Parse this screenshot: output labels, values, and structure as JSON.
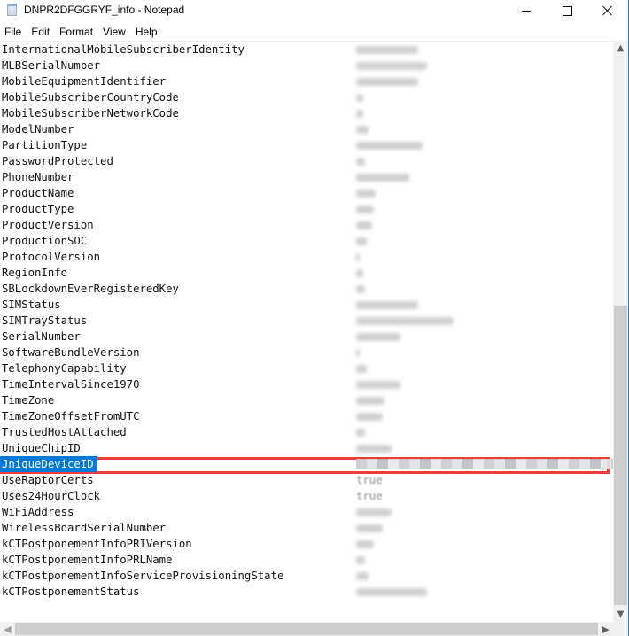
{
  "window": {
    "title": "DNPR2DFGGRYF_info - Notepad",
    "controls": {
      "minimize": "minimize",
      "maximize": "maximize",
      "close": "close"
    }
  },
  "menu": {
    "items": [
      "File",
      "Edit",
      "Format",
      "View",
      "Help"
    ]
  },
  "editor": {
    "selected_key": "UniqueDeviceID",
    "selected_text_visible": "JniqueDeviceID",
    "rows": [
      {
        "key": "InternationalMobileSubscriberIdentity",
        "value": "[redacted]"
      },
      {
        "key": "MLBSerialNumber",
        "value": "[redacted]"
      },
      {
        "key": "MobileEquipmentIdentifier",
        "value": "[redacted]"
      },
      {
        "key": "MobileSubscriberCountryCode",
        "value": "[redacted]"
      },
      {
        "key": "MobileSubscriberNetworkCode",
        "value": "[redacted]"
      },
      {
        "key": "ModelNumber",
        "value": "[redacted]"
      },
      {
        "key": "PartitionType",
        "value": "[redacted]"
      },
      {
        "key": "PasswordProtected",
        "value": "[redacted]"
      },
      {
        "key": "PhoneNumber",
        "value": "[redacted]"
      },
      {
        "key": "ProductName",
        "value": "[redacted]"
      },
      {
        "key": "ProductType",
        "value": "[redacted]"
      },
      {
        "key": "ProductVersion",
        "value": "[redacted]"
      },
      {
        "key": "ProductionSOC",
        "value": "[redacted]"
      },
      {
        "key": "ProtocolVersion",
        "value": "[redacted]"
      },
      {
        "key": "RegionInfo",
        "value": "[redacted]"
      },
      {
        "key": "SBLockdownEverRegisteredKey",
        "value": "[redacted]"
      },
      {
        "key": "SIMStatus",
        "value": "[redacted]"
      },
      {
        "key": "SIMTrayStatus",
        "value": "[redacted]"
      },
      {
        "key": "SerialNumber",
        "value": "[redacted]"
      },
      {
        "key": "SoftwareBundleVersion",
        "value": "[redacted]"
      },
      {
        "key": "TelephonyCapability",
        "value": "[redacted]"
      },
      {
        "key": "TimeIntervalSince1970",
        "value": "[redacted]"
      },
      {
        "key": "TimeZone",
        "value": "[redacted]"
      },
      {
        "key": "TimeZoneOffsetFromUTC",
        "value": "[redacted]"
      },
      {
        "key": "TrustedHostAttached",
        "value": "[redacted]"
      },
      {
        "key": "UniqueChipID",
        "value": "[redacted]"
      },
      {
        "key": "JniqueDeviceID",
        "value": "[pixelated]"
      },
      {
        "key": "UseRaptorCerts",
        "value": "true"
      },
      {
        "key": "Uses24HourClock",
        "value": "true"
      },
      {
        "key": "WiFiAddress",
        "value": "[redacted]"
      },
      {
        "key": "WirelessBoardSerialNumber",
        "value": "[redacted]"
      },
      {
        "key": "kCTPostponementInfoPRIVersion",
        "value": "[redacted]"
      },
      {
        "key": "kCTPostponementInfoPRLName",
        "value": "[redacted]"
      },
      {
        "key": "kCTPostponementInfoServiceProvisioningState",
        "value": "[redacted]"
      },
      {
        "key": "kCTPostponementStatus",
        "value": "[redacted]"
      }
    ]
  },
  "annotation": {
    "highlight_color": "#ef3b3b",
    "highlighted_row": "UniqueDeviceID"
  },
  "colors": {
    "selection": "#0078d7",
    "window_border": "#2b7fd8"
  }
}
